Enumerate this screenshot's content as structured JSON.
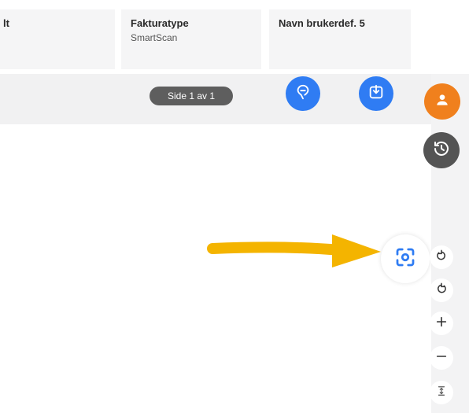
{
  "header": {
    "columns": [
      {
        "label": "lt",
        "value": ""
      },
      {
        "label": "Fakturatype",
        "value": "SmartScan"
      },
      {
        "label": "Navn brukerdef. 5",
        "value": ""
      }
    ]
  },
  "toolbar": {
    "page_indicator": "Side 1 av 1"
  },
  "icons": {
    "pin": "map-pin-icon",
    "download": "download-icon",
    "user": "user-icon",
    "history": "history-icon",
    "focus": "focus-scan-icon",
    "rotate_left": "rotate-left-icon",
    "rotate_right": "rotate-right-icon",
    "zoom_in": "zoom-in-icon",
    "zoom_out": "zoom-out-icon",
    "fit_height": "fit-height-icon",
    "annotation_arrow": "yellow-arrow-annotation"
  },
  "colors": {
    "accent_blue": "#2f7cf3",
    "orange": "#f0801d",
    "dark_grey": "#545454",
    "arrow_yellow": "#f4b400"
  }
}
